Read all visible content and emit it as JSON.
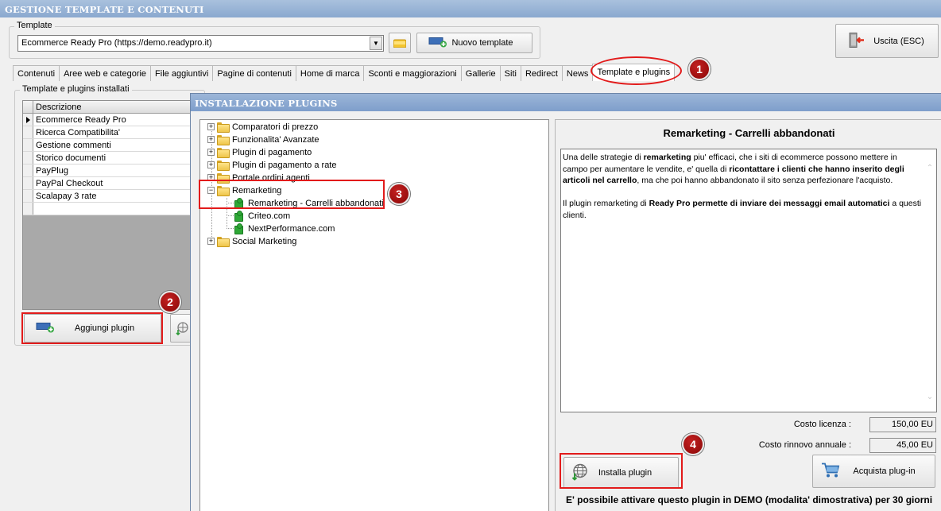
{
  "window": {
    "title": "GESTIONE TEMPLATE E CONTENUTI"
  },
  "template_group": {
    "label": "Template",
    "selected": "Ecommerce Ready Pro (https://demo.readypro.it)",
    "new_template_button": "Nuovo template"
  },
  "exit_button": "Uscita (ESC)",
  "tabs": [
    {
      "label": "Contenuti"
    },
    {
      "label": "Aree web e categorie"
    },
    {
      "label": "File aggiuntivi"
    },
    {
      "label": "Pagine di contenuti"
    },
    {
      "label": "Home di marca"
    },
    {
      "label": "Sconti e maggiorazioni"
    },
    {
      "label": "Gallerie"
    },
    {
      "label": "Siti"
    },
    {
      "label": "Redirect"
    },
    {
      "label": "News"
    },
    {
      "label": "Template e plugins"
    }
  ],
  "installed_group": {
    "label": "Template e plugins installati",
    "column_header": "Descrizione",
    "rows": [
      "Ecommerce Ready Pro",
      "Ricerca Compatibilita'",
      "Gestione commenti",
      "Storico documenti",
      "PayPlug",
      "PayPal Checkout",
      "Scalapay 3 rate"
    ],
    "add_button": "Aggiungi plugin"
  },
  "dialog": {
    "title": "INSTALLAZIONE PLUGINS",
    "tree": [
      {
        "label": "Comparatori di prezzo"
      },
      {
        "label": "Funzionalita' Avanzate"
      },
      {
        "label": "Plugin di pagamento"
      },
      {
        "label": "Plugin di pagamento a rate"
      },
      {
        "label": "Portale ordini agenti"
      },
      {
        "label": "Remarketing"
      },
      {
        "label": "Remarketing - Carrelli abbandonati"
      },
      {
        "label": "Criteo.com"
      },
      {
        "label": "NextPerformance.com"
      },
      {
        "label": "Social Marketing"
      }
    ],
    "plugin": {
      "title": "Remarketing - Carrelli abbandonati",
      "desc": {
        "p1a": "Una delle strategie di ",
        "p1b": "remarketing",
        "p1c": " piu' efficaci, che i siti di ecommerce possono mettere in campo per aumentare le vendite, e' quella di ",
        "p1d": "ricontattare i clienti che hanno inserito degli articoli nel carrello",
        "p1e": ", ma che poi hanno abbandonato il sito senza perfezionare l'acquisto.",
        "p2a": "Il plugin remarketing di ",
        "p2b": "Ready Pro permette di inviare dei messaggi email automatici",
        "p2c": " a questi clienti."
      },
      "license_label": "Costo licenza :",
      "license_value": "150,00 EU",
      "renewal_label": "Costo rinnovo annuale :",
      "renewal_value": "45,00 EU",
      "install_button": "Installa plugin",
      "buy_button": "Acquista plug-in",
      "demo_note": "E' possibile attivare questo plugin in DEMO (modalita' dimostrativa) per 30 giorni"
    }
  },
  "annotations": {
    "b1": "1",
    "b2": "2",
    "b3": "3",
    "b4": "4"
  },
  "colors": {
    "highlight": "#e21b1b",
    "titlebar": "#8aa8cf",
    "badge": "#a01010"
  }
}
